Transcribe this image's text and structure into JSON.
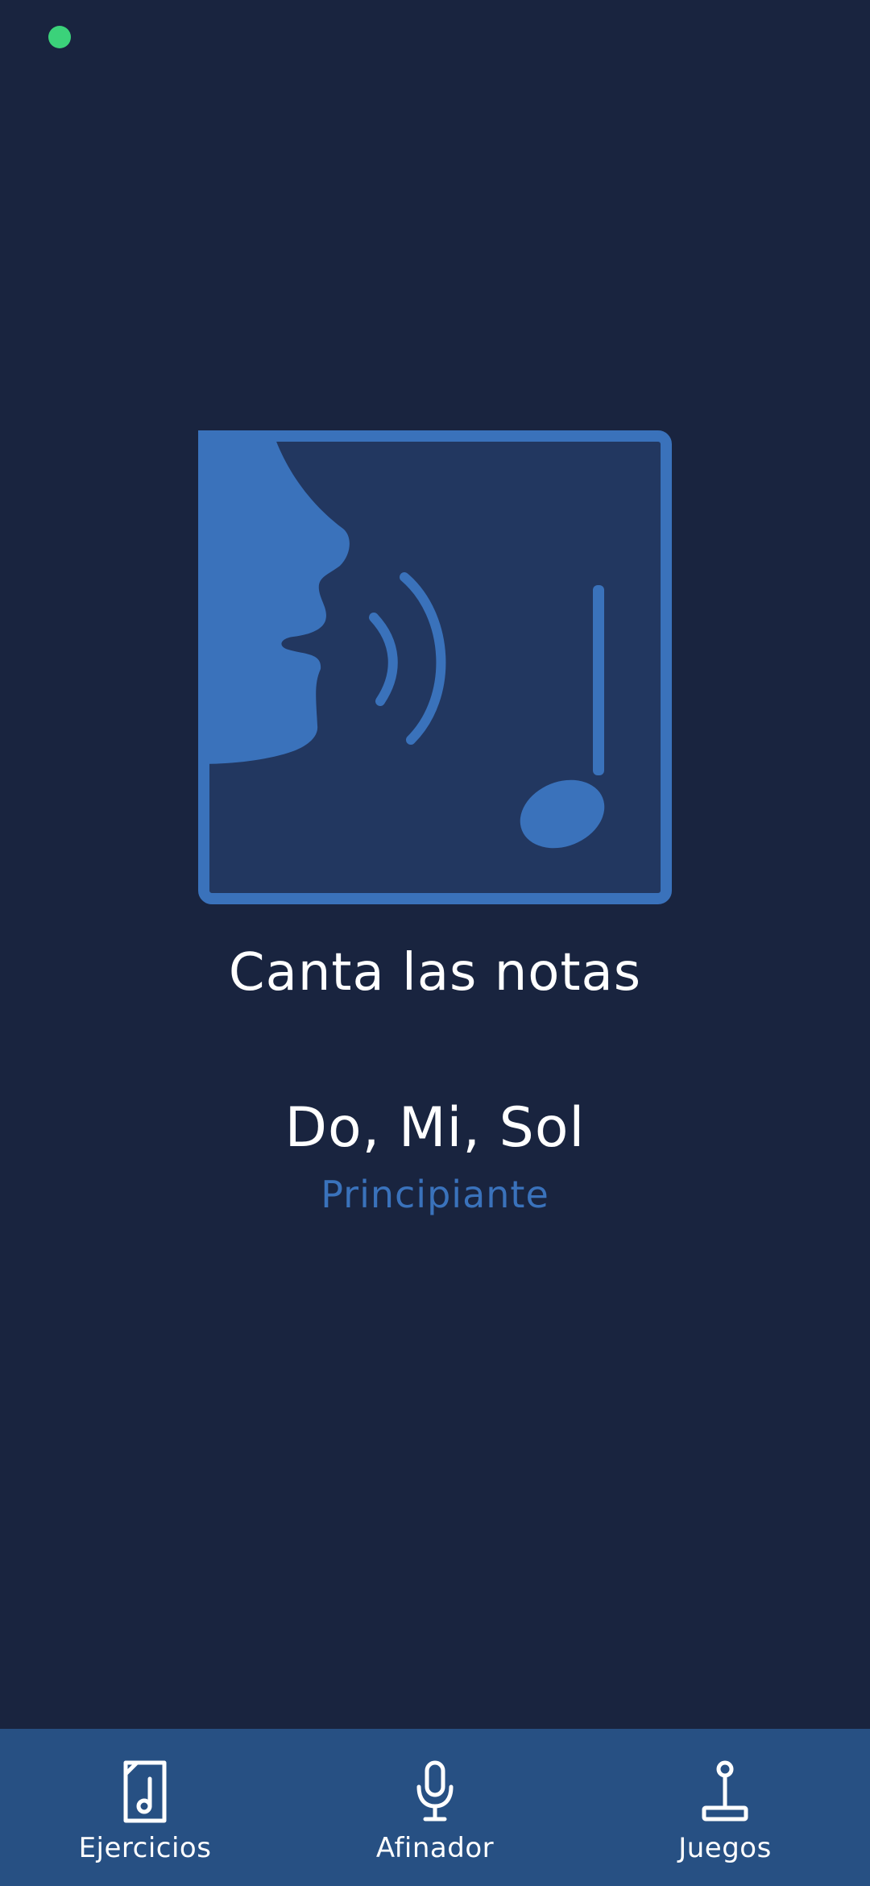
{
  "status": {
    "indicator_color": "#3bd27a"
  },
  "illustration": {
    "icon": "singing-face-note-icon",
    "frame_color": "#3a72bb",
    "fill_color": "#223760"
  },
  "game": {
    "title": "Canta las notas",
    "exercise_name": "Do, Mi, Sol",
    "level": "Principiante"
  },
  "nav": {
    "items": [
      {
        "label": "Ejercicios",
        "icon": "sheet-music-icon"
      },
      {
        "label": "Afinador",
        "icon": "microphone-icon"
      },
      {
        "label": "Juegos",
        "icon": "joystick-icon"
      }
    ]
  },
  "colors": {
    "background": "#19243f",
    "nav_background": "#275083",
    "accent": "#3a72bb",
    "text": "#ffffff"
  }
}
